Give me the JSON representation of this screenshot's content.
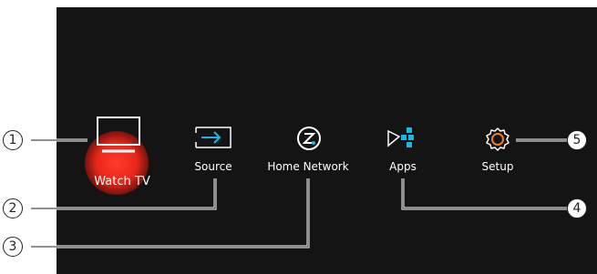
{
  "menu": {
    "items": [
      {
        "label": "Watch TV",
        "icon": "tv-icon",
        "selected": true
      },
      {
        "label": "Source",
        "icon": "source-input-icon",
        "selected": false
      },
      {
        "label": "Home Network",
        "icon": "home-network-icon",
        "selected": false
      },
      {
        "label": "Apps",
        "icon": "apps-icon",
        "selected": false
      },
      {
        "label": "Setup",
        "icon": "gear-icon",
        "selected": false
      }
    ]
  },
  "callouts": [
    "1",
    "2",
    "3",
    "4",
    "5"
  ],
  "colors": {
    "background": "#141414",
    "highlight": "#e8261a",
    "accent": "#1ab6e8",
    "text": "#ffffff"
  }
}
